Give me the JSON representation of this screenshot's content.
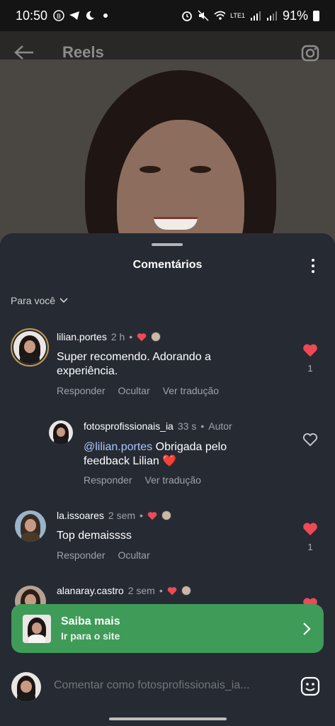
{
  "status": {
    "time": "10:50",
    "battery": "91%",
    "network": "LTE1"
  },
  "header": {
    "title": "Reels"
  },
  "sheet": {
    "title": "Comentários",
    "filter_label": "Para você"
  },
  "comments": [
    {
      "user": "lilian.portes",
      "time": "2 h",
      "text": "Super recomendo.  Adorando a experiência.",
      "actions": [
        "Responder",
        "Ocultar",
        "Ver tradução"
      ],
      "likes": "1",
      "liked": true
    },
    {
      "user": "fotosprofissionais_ia",
      "time": "33 s",
      "author_badge": "Autor",
      "mention": "@lilian.portes",
      "text": " Obrigada pelo feedback Lilian",
      "emoji": "❤️",
      "actions": [
        "Responder",
        "Ver tradução"
      ],
      "liked": false
    },
    {
      "user": "la.issoares",
      "time": "2 sem",
      "text": "Top demaissss",
      "actions": [
        "Responder",
        "Ocultar"
      ],
      "likes": "1",
      "liked": true
    },
    {
      "user": "alanaray.castro",
      "time": "2 sem",
      "liked": true
    }
  ],
  "cta": {
    "title": "Saiba mais",
    "subtitle": "Ir para o site"
  },
  "input": {
    "placeholder": "Comentar como fotosprofissionais_ia..."
  },
  "colors": {
    "sheet_bg": "#262a33",
    "cta_green": "#3f9b58",
    "heart_red": "#ed4956",
    "mention_blue": "#a9c7ff"
  }
}
